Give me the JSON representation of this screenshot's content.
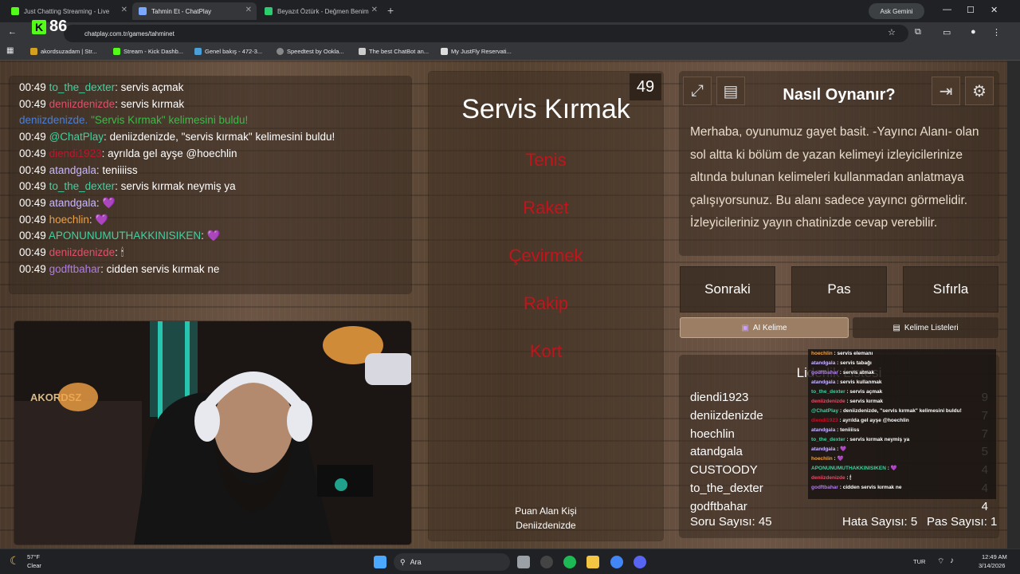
{
  "browser": {
    "tabs": [
      {
        "label": "Just Chatting Streaming - Live",
        "color": "#53fc18"
      },
      {
        "label": "Tahmin Et - ChatPlay",
        "color": "#7aa7ff"
      },
      {
        "label": "Beyazıt Öztürk - Değmen Benim",
        "color": "#2ecc71"
      }
    ],
    "gemini": "Ask Gemini",
    "url": "chatplay.com.tr/games/tahminet",
    "kick_count": "86",
    "bookmarks": [
      "akordsuzadam | Str...",
      "Stream - Kick Dashb...",
      "Genel bakış - 472-3...",
      "Speedtest by Ookla...",
      "The best ChatBot an...",
      "My JustFly Reservati..."
    ]
  },
  "chat": [
    {
      "time": "00:49",
      "user": "to_the_dexter",
      "color": "#3fd1a0",
      "text": "servis açmak"
    },
    {
      "time": "00:49",
      "user": "deniizdenizde",
      "color": "#e0506a",
      "text": "servis kırmak"
    },
    {
      "time": "",
      "user": "deniizdenizde.",
      "color": "#4a7fd6",
      "text": "\"Servis Kırmak\" kelimesini buldu!",
      "special": true
    },
    {
      "time": "00:49",
      "user": "@ChatPlay",
      "color": "#3fd1a0",
      "text": "deniizdenizde, \"servis kırmak\" kelimesini buldu!"
    },
    {
      "time": "00:49",
      "user": "diendi1923",
      "color": "#c0142a",
      "text": "ayrılda gel ayşe @hoechlin"
    },
    {
      "time": "00:49",
      "user": "atandgala",
      "color": "#c9b7ff",
      "text": "teniiiiss"
    },
    {
      "time": "00:49",
      "user": "to_the_dexter",
      "color": "#3fd1a0",
      "text": "servis kırmak neymiş ya"
    },
    {
      "time": "00:49",
      "user": "atandgala",
      "color": "#c9b7ff",
      "text": "💜"
    },
    {
      "time": "00:49",
      "user": "hoechlin",
      "color": "#f0a040",
      "text": "💜"
    },
    {
      "time": "00:49",
      "user": "APONUNUMUTHAKKINISIKEN",
      "color": "#3fd1a0",
      "text": "💜"
    },
    {
      "time": "00:49",
      "user": "deniizdenizde",
      "color": "#e0506a",
      "text": "🕯"
    },
    {
      "time": "00:49",
      "user": "godftbahar",
      "color": "#b07de8",
      "text": "cidden servis kırmak ne"
    }
  ],
  "game": {
    "timer": "49",
    "word": "Servis Kırmak",
    "forbidden": [
      "Tenis",
      "Raket",
      "Çevirmek",
      "Rakip",
      "Kort"
    ],
    "scorer_label": "Puan Alan Kişi",
    "scorer": "Deniizdenizde"
  },
  "howto": {
    "title": "Nasıl Oynanır?",
    "text": "Merhaba, oyunumuz gayet basit. -Yayıncı Alanı- olan sol altta ki bölüm de yazan kelimeyi izleyicilerinize altında bulunan kelimeleri kullanmadan anlatmaya çalışıyorsunuz. Bu alanı sadece yayıncı görmelidir. İzleyicileriniz yayın chatinizde cevap verebilir."
  },
  "actions": {
    "next": "Sonraki",
    "pass": "Pas",
    "reset": "Sıfırla",
    "ai_tab": "AI Kelime",
    "lists_tab": "Kelime Listeleri"
  },
  "leaderboard": {
    "title": "Liderlik Listesi",
    "rows": [
      {
        "name": "diendi1923",
        "score": "9"
      },
      {
        "name": "deniizdenizde",
        "score": "7"
      },
      {
        "name": "hoechlin",
        "score": "7"
      },
      {
        "name": "atandgala",
        "score": "5"
      },
      {
        "name": "CUSTOODY",
        "score": "4"
      },
      {
        "name": "to_the_dexter",
        "score": "4"
      },
      {
        "name": "godftbahar",
        "score": "4"
      }
    ],
    "questions": "Soru Sayısı: 45",
    "errors": "Hata Sayısı: 5",
    "passes": "Pas Sayısı: 1"
  },
  "overlay_chat": [
    {
      "user": "hoechlin",
      "color": "#f0a040",
      "text": "servis elemanı"
    },
    {
      "user": "atandgala",
      "color": "#c9b7ff",
      "text": "servis tabağı"
    },
    {
      "user": "godftbahar",
      "color": "#b07de8",
      "text": "servis atmak"
    },
    {
      "user": "atandgala",
      "color": "#c9b7ff",
      "text": "servis kullanmak"
    },
    {
      "user": "to_the_dexter",
      "color": "#3fd1a0",
      "text": "servis açmak"
    },
    {
      "user": "deniizdenizde",
      "color": "#e0506a",
      "text": "servis kırmak"
    },
    {
      "user": "@ChatPlay",
      "color": "#3fd1a0",
      "text": "deniizdenizde, \"servis kırmak\" kelimesini buldu!"
    },
    {
      "user": "diendi1923",
      "color": "#c0142a",
      "text": "ayrılda gel ayşe @hoechlin"
    },
    {
      "user": "atandgala",
      "color": "#c9b7ff",
      "text": "teniiiiss"
    },
    {
      "user": "to_the_dexter",
      "color": "#3fd1a0",
      "text": "servis kırmak neymiş ya"
    },
    {
      "user": "atandgala",
      "color": "#c9b7ff",
      "text": "💜"
    },
    {
      "user": "hoechlin",
      "color": "#f0a040",
      "text": "💜"
    },
    {
      "user": "APONUNUMUTHAKKINISIKEN",
      "color": "#3fd1a0",
      "text": "💜"
    },
    {
      "user": "deniizdenizde",
      "color": "#e0506a",
      "text": "🕯"
    },
    {
      "user": "godftbahar",
      "color": "#b07de8",
      "text": "cidden servis kırmak ne"
    }
  ],
  "taskbar": {
    "temp": "57°F",
    "weather": "Clear",
    "search": "Ara",
    "lang": "TUR",
    "time": "12:49 AM",
    "date": "3/14/2026"
  }
}
